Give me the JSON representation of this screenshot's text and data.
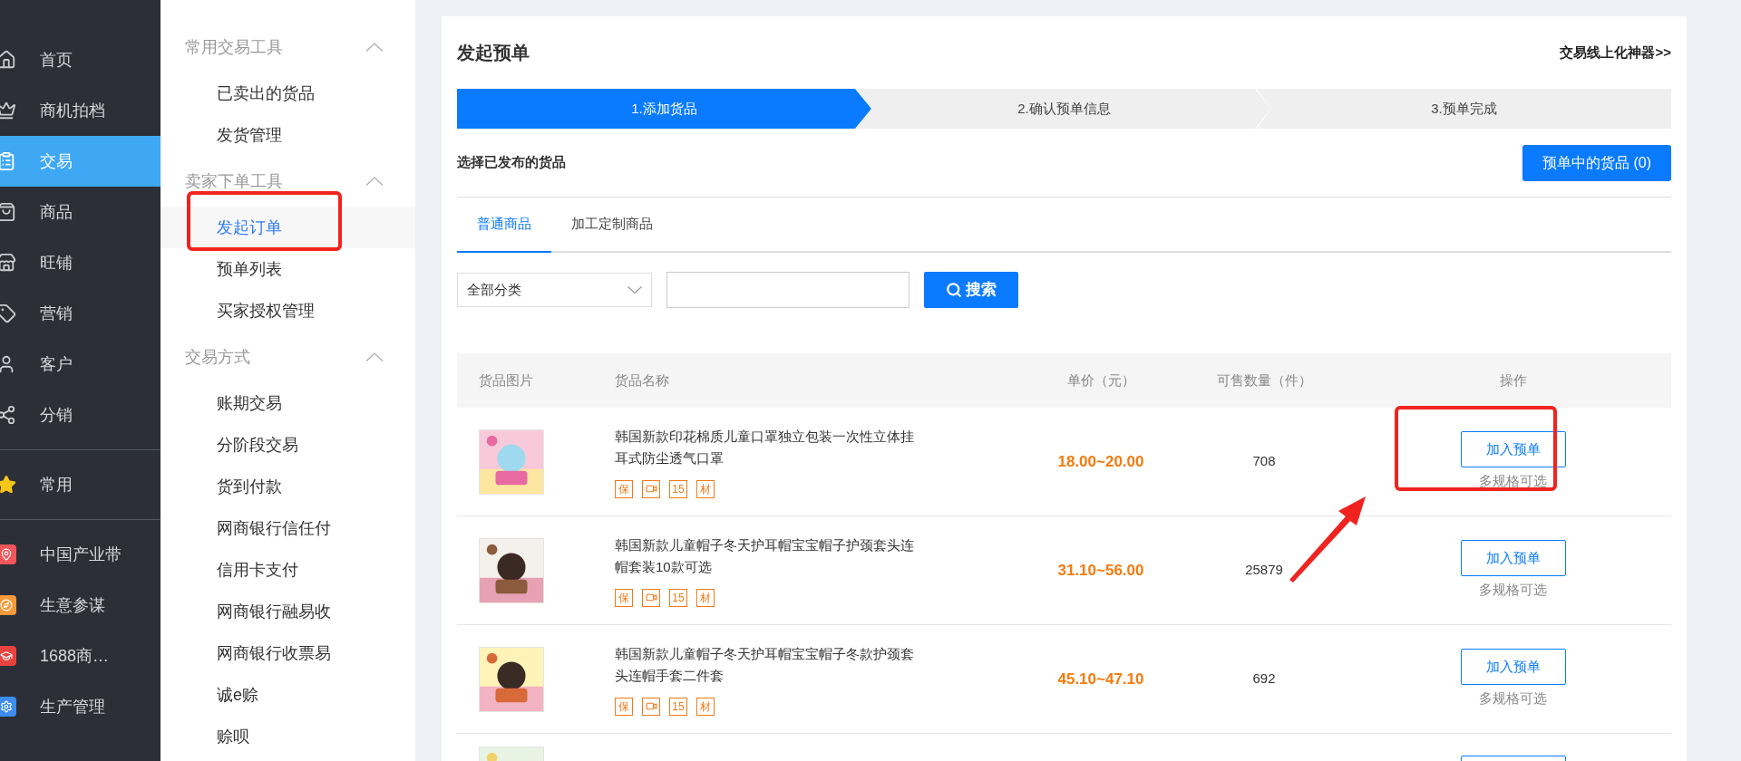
{
  "sidebar": {
    "groups": [
      [
        {
          "label": "首页",
          "selected": false
        },
        {
          "label": "商机拍档",
          "selected": false
        },
        {
          "label": "交易",
          "selected": true
        },
        {
          "label": "商品",
          "selected": false
        },
        {
          "label": "旺铺",
          "selected": false
        },
        {
          "label": "营销",
          "selected": false
        },
        {
          "label": "客户",
          "selected": false
        },
        {
          "label": "分销",
          "selected": false
        }
      ],
      [
        {
          "label": "常用",
          "selected": false
        }
      ],
      [
        {
          "label": "中国产业带",
          "selected": false
        },
        {
          "label": "生意参谋",
          "selected": false
        },
        {
          "label": "1688商…",
          "selected": false
        },
        {
          "label": "生产管理",
          "selected": false
        }
      ]
    ]
  },
  "subnav": {
    "sections": [
      {
        "title": "常用交易工具",
        "expanded": true,
        "items": [
          {
            "label": "已卖出的货品",
            "selected": false
          },
          {
            "label": "发货管理",
            "selected": false
          }
        ]
      },
      {
        "title": "卖家下单工具",
        "expanded": true,
        "items": [
          {
            "label": "发起订单",
            "selected": true
          },
          {
            "label": "预单列表",
            "selected": false
          },
          {
            "label": "买家授权管理",
            "selected": false
          }
        ]
      },
      {
        "title": "交易方式",
        "expanded": true,
        "items": [
          {
            "label": "账期交易",
            "selected": false
          },
          {
            "label": "分阶段交易",
            "selected": false
          },
          {
            "label": "货到付款",
            "selected": false
          },
          {
            "label": "网商银行信任付",
            "selected": false
          },
          {
            "label": "信用卡支付",
            "selected": false
          },
          {
            "label": "网商银行融易收",
            "selected": false
          },
          {
            "label": "网商银行收票易",
            "selected": false
          },
          {
            "label": "诚e赊",
            "selected": false
          },
          {
            "label": "赊呗",
            "selected": false
          }
        ]
      }
    ]
  },
  "page_title": "发起预单",
  "top_link": "交易线上化神器>>",
  "steps": [
    {
      "label": "1.添加货品",
      "selected": true
    },
    {
      "label": "2.确认预单信息",
      "selected": false
    },
    {
      "label": "3.预单完成",
      "selected": false
    }
  ],
  "section_label": "选择已发布的货品",
  "cart_button": "预单中的货品 (0)",
  "tabs": [
    {
      "label": "普通商品",
      "selected": true
    },
    {
      "label": "加工定制商品",
      "selected": false
    }
  ],
  "filter": {
    "category": "全部分类",
    "search_button": "搜索"
  },
  "table": {
    "columns": [
      "货品图片",
      "货品名称",
      "单价（元）",
      "可售数量（件）",
      "操作"
    ],
    "rows": [
      {
        "name": "韩国新款印花棉质儿童口罩独立包装一次性立体挂耳式防尘透气口罩",
        "price": "18.00~20.00",
        "quantity": "708",
        "action": "加入预单",
        "note": "多规格可选",
        "badges": [
          {
            "kind": "text",
            "label": "保"
          },
          {
            "kind": "video"
          },
          {
            "kind": "text",
            "label": "15"
          },
          {
            "kind": "text",
            "label": "材"
          }
        ]
      },
      {
        "name": "韩国新款儿童帽子冬天护耳帽宝宝帽子护颈套头连帽套装10款可选",
        "price": "31.10~56.00",
        "quantity": "25879",
        "action": "加入预单",
        "note": "多规格可选",
        "badges": [
          {
            "kind": "text",
            "label": "保"
          },
          {
            "kind": "video"
          },
          {
            "kind": "text",
            "label": "15"
          },
          {
            "kind": "text",
            "label": "材"
          }
        ]
      },
      {
        "name": "韩国新款儿童帽子冬天护耳帽宝宝帽子冬款护颈套头连帽手套二件套",
        "price": "45.10~47.10",
        "quantity": "692",
        "action": "加入预单",
        "note": "多规格可选",
        "badges": [
          {
            "kind": "text",
            "label": "保"
          },
          {
            "kind": "video"
          },
          {
            "kind": "text",
            "label": "15"
          },
          {
            "kind": "text",
            "label": "材"
          }
        ]
      }
    ]
  }
}
